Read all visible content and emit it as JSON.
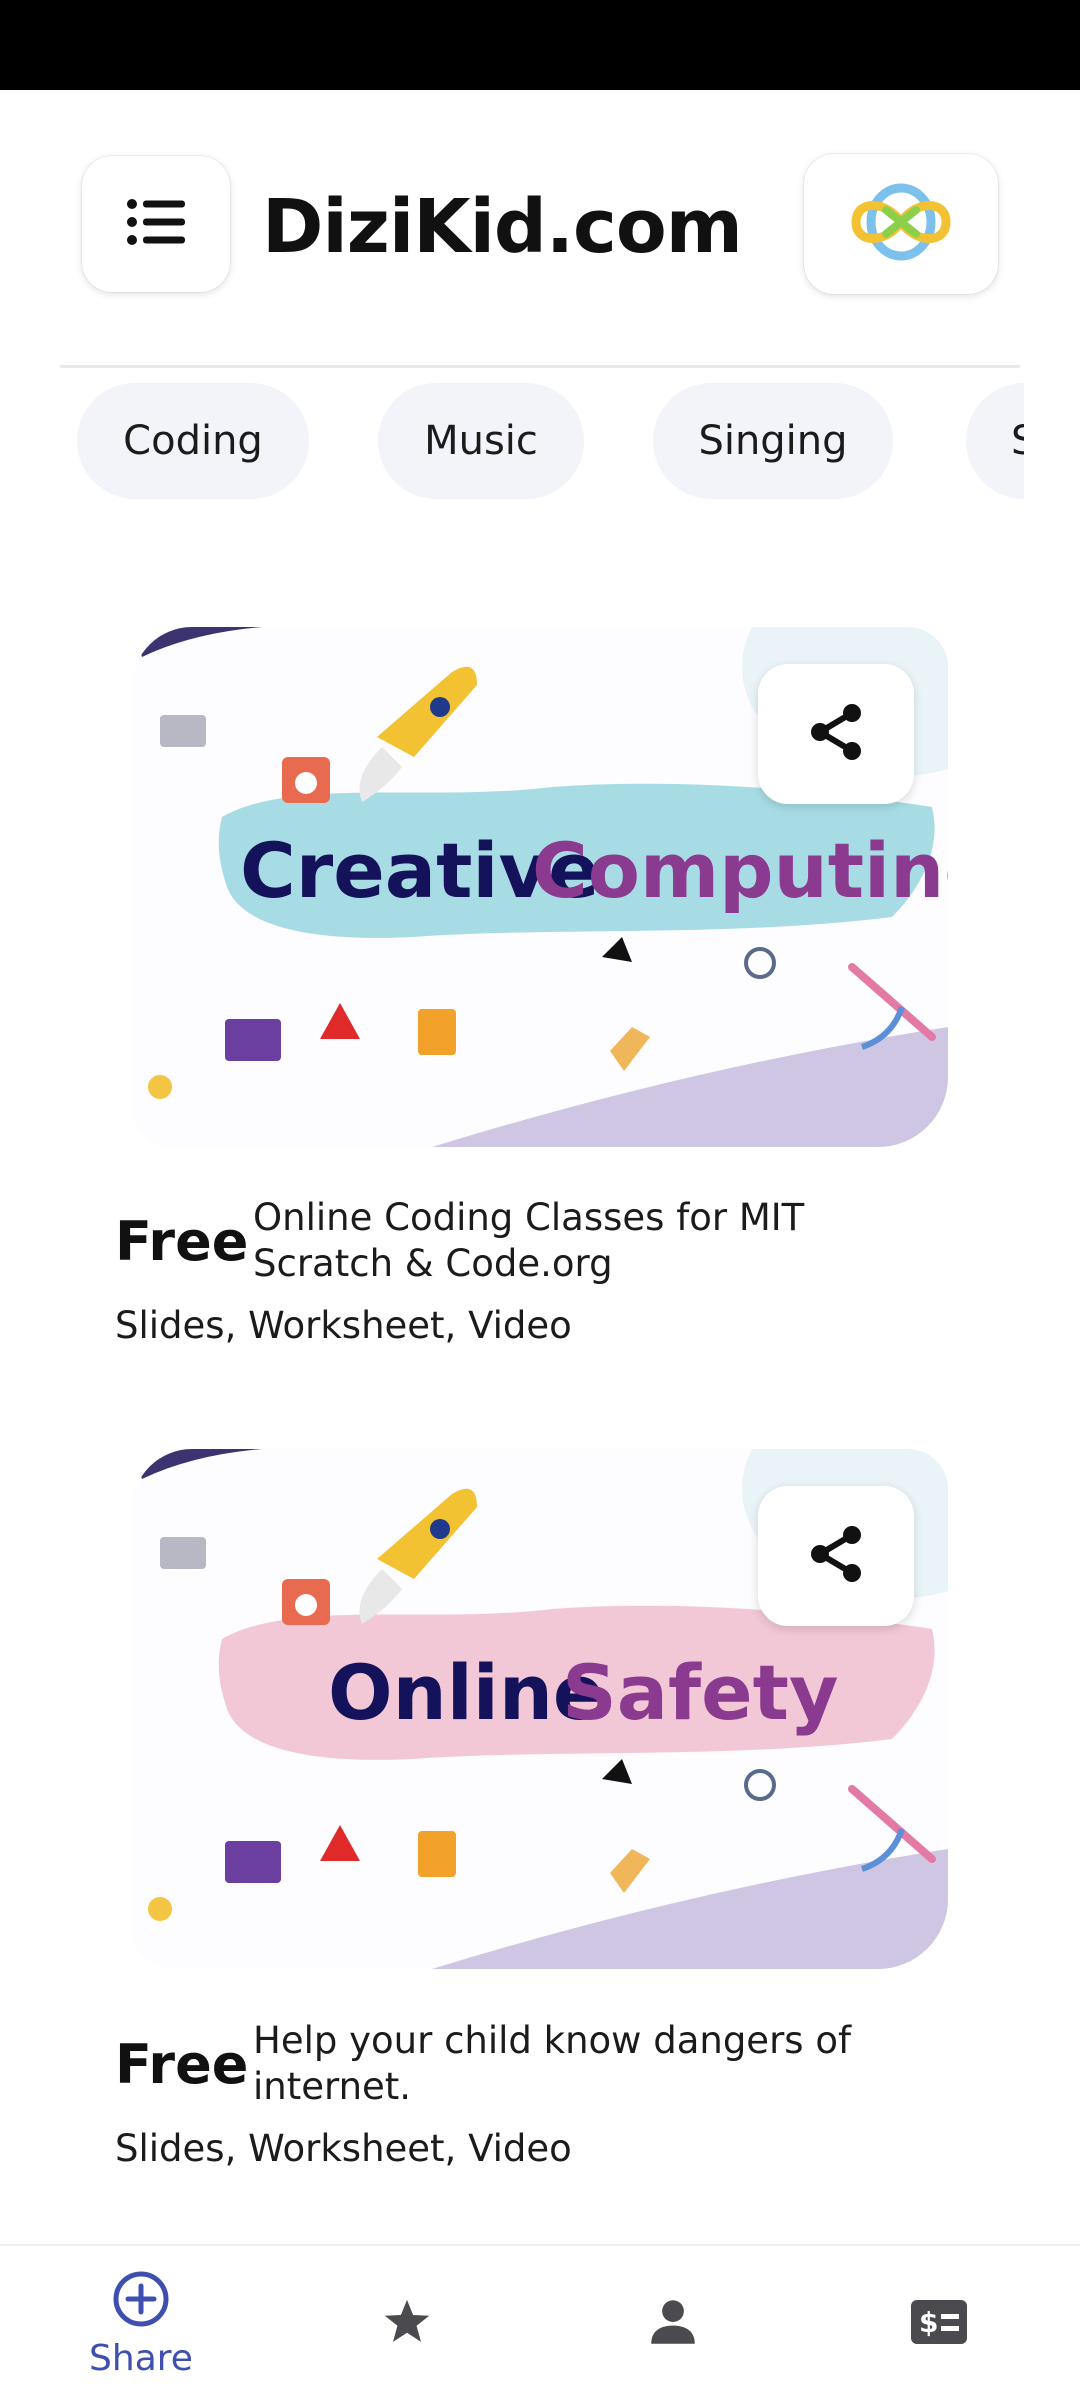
{
  "header": {
    "title": "DiziKid.com",
    "menu_icon": "list-menu-icon",
    "logo_icon": "infinity-logo-icon"
  },
  "categories": [
    "Coding",
    "Music",
    "Singing",
    "S"
  ],
  "courses": [
    {
      "banner_title_dark": "Creative",
      "banner_title_accent": "Computing",
      "splash_color": "#a8dce4",
      "price": "Free",
      "description": "Online Coding Classes for MIT Scratch & Code.org",
      "formats": "Slides, Worksheet, Video"
    },
    {
      "banner_title_dark": "Online",
      "banner_title_accent": "Safety",
      "splash_color": "#f3c8d6",
      "price": "Free",
      "description": "Help your child know dangers of internet.",
      "formats": "Slides, Worksheet, Video"
    }
  ],
  "bottom_nav": [
    {
      "label": "Share",
      "icon": "add-circle-icon",
      "active": true
    },
    {
      "label": "",
      "icon": "star-icon",
      "active": false
    },
    {
      "label": "",
      "icon": "person-icon",
      "active": false
    },
    {
      "label": "",
      "icon": "pricing-icon",
      "active": false
    }
  ],
  "colors": {
    "accent": "#3f4fb0",
    "title_dark": "#14125a",
    "title_accent": "#8a3a8f",
    "chip_bg": "#f3f4f9"
  }
}
